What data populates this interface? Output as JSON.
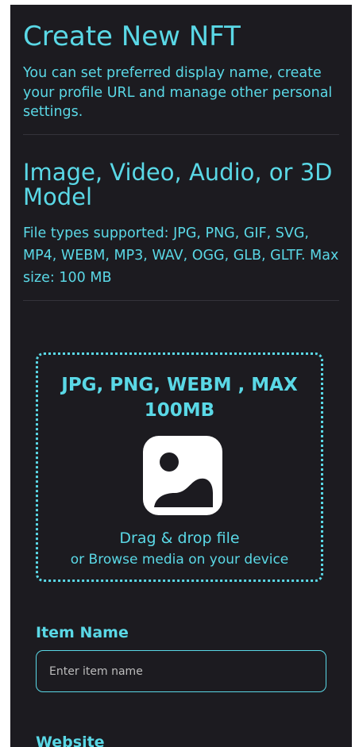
{
  "header": {
    "title": "Create New NFT",
    "subtitle": "You can set preferred display name, create your profile URL and manage other personal settings."
  },
  "media_section": {
    "title": "Image, Video, Audio, or 3D Model",
    "description": "File types supported: JPG, PNG, GIF, SVG, MP4, WEBM, MP3, WAV, OGG, GLB, GLTF. Max size: 100 MB"
  },
  "dropzone": {
    "formats": "JPG, PNG, WEBM , MAX 100MB",
    "icon": "image-icon",
    "primary_text": "Drag & drop file",
    "secondary_text": "or Browse media on your device"
  },
  "form": {
    "item_name_label": "Item Name",
    "item_name_placeholder": "Enter item name",
    "item_name_value": "",
    "website_label": "Website"
  },
  "colors": {
    "panel_background": "#1c1b20",
    "accent": "#5ad8e6",
    "divider": "#34333a"
  }
}
